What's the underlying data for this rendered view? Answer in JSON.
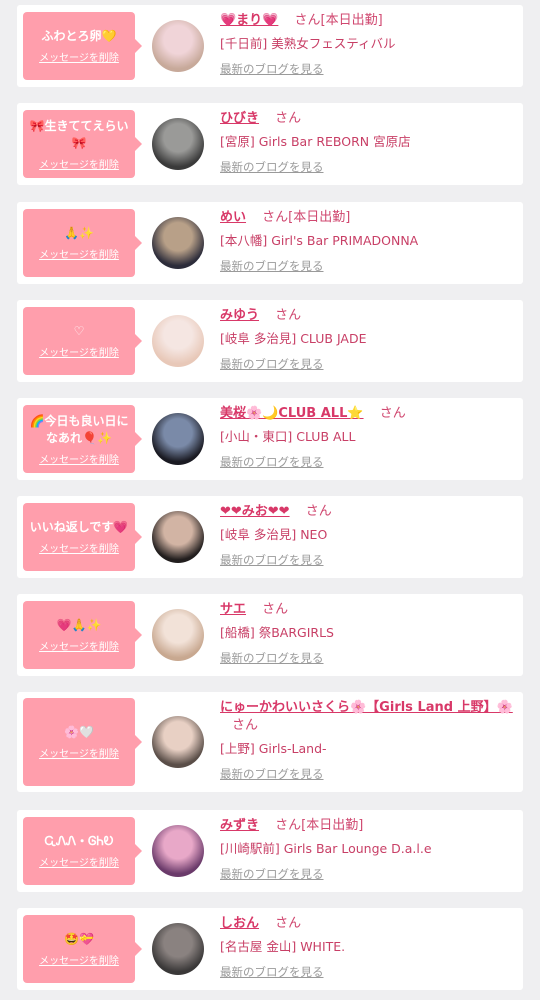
{
  "delete_label": "メッセージを削除",
  "blog_label": "最新のブログを見る",
  "entries": [
    {
      "message": "ふわとろ卵💛",
      "name": "💗まり💗",
      "suffix": "さん",
      "status": "[本日出勤]",
      "shop": "[千日前] 美熟女フェスティバル",
      "avatar_colors": [
        "#c7a99a",
        "#f0d4d8"
      ]
    },
    {
      "message": "🎀生きててえらい🎀",
      "name": "ひびき",
      "suffix": "さん",
      "status": "",
      "shop": "[宮原] Girls Bar REBORN 宮原店",
      "avatar_colors": [
        "#3a3a3a",
        "#9a9a98"
      ]
    },
    {
      "message": "🙏✨",
      "name": "めい",
      "suffix": "さん",
      "status": "[本日出勤]",
      "shop": "[本八幡] Girl's Bar PRIMADONNA",
      "avatar_colors": [
        "#2c2c3a",
        "#b8a088"
      ]
    },
    {
      "message": "♡",
      "name": "みゆう",
      "suffix": "さん",
      "status": "",
      "shop": "[岐阜 多治見] CLUB JADE",
      "avatar_colors": [
        "#e8c8b8",
        "#f5e6e2"
      ]
    },
    {
      "message": "🌈今日も良い日になあれ🎈✨",
      "name": "美桜🌸🌙CLUB ALL⭐",
      "suffix": "さん",
      "status": "",
      "shop": "[小山・東口] CLUB ALL",
      "avatar_colors": [
        "#1a1a22",
        "#7a8aa8"
      ]
    },
    {
      "message": "いいね返しです💗",
      "name": "❤❤みお❤❤",
      "suffix": "さん",
      "status": "",
      "shop": "[岐阜 多治見] NEO",
      "avatar_colors": [
        "#221e1e",
        "#d2b4a4"
      ]
    },
    {
      "message": "💗🙏✨",
      "name": "サエ",
      "suffix": "さん",
      "status": "",
      "shop": "[船橋] 祭BARGIRLS",
      "avatar_colors": [
        "#c8a890",
        "#f2e2d8"
      ]
    },
    {
      "message": "🌸🤍",
      "name": "にゅーかわいいさくら🌸【Girls Land 上野】🌸",
      "suffix": "さん",
      "status": "",
      "shop": "[上野] Girls-Land-",
      "avatar_colors": [
        "#5a4e48",
        "#e8d0c4"
      ]
    },
    {
      "message": "ᏩᏁᏁ・ᎶᏂᎧ",
      "name": "みずき",
      "suffix": "さん",
      "status": "[本日出勤]",
      "shop": "[川崎駅前] Girls Bar Lounge D.a.l.e",
      "avatar_colors": [
        "#6a3a6a",
        "#e8a8c8"
      ]
    },
    {
      "message": "🤩💝",
      "name": "しおん",
      "suffix": "さん",
      "status": "",
      "shop": "[名古屋 金山] WHITE.",
      "avatar_colors": [
        "#3a3838",
        "#8a8280"
      ]
    }
  ]
}
